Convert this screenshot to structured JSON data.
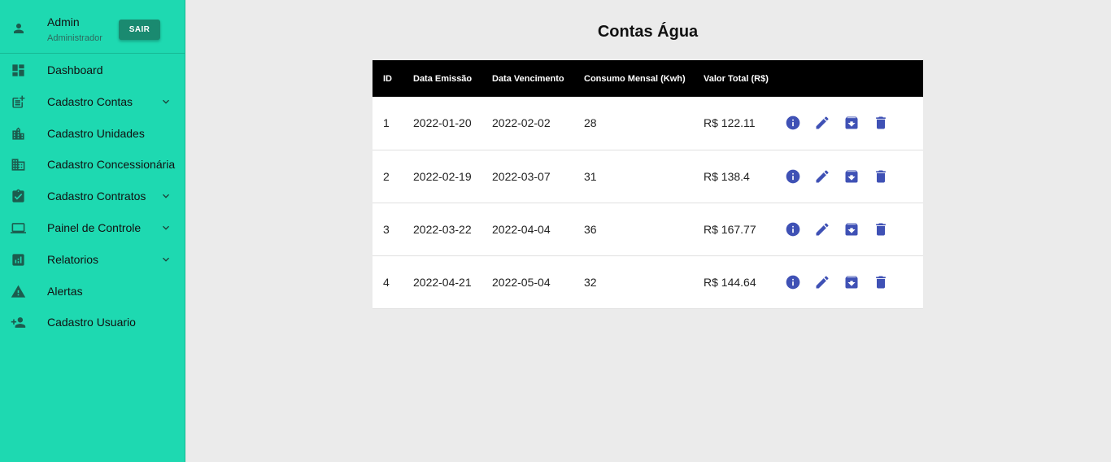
{
  "user": {
    "name": "Admin",
    "role": "Administrador",
    "logout_label": "SAIR"
  },
  "sidebar": {
    "items": [
      {
        "label": "Dashboard",
        "icon": "dashboard-icon",
        "expandable": false
      },
      {
        "label": "Cadastro Contas",
        "icon": "post-add-icon",
        "expandable": true
      },
      {
        "label": "Cadastro Unidades",
        "icon": "location-city-icon",
        "expandable": false
      },
      {
        "label": "Cadastro Concessionária",
        "icon": "business-icon",
        "expandable": false
      },
      {
        "label": "Cadastro Contratos",
        "icon": "assignment-turned-in-icon",
        "expandable": true
      },
      {
        "label": "Painel de Controle",
        "icon": "laptop-icon",
        "expandable": true
      },
      {
        "label": "Relatorios",
        "icon": "analytics-icon",
        "expandable": true
      },
      {
        "label": "Alertas",
        "icon": "warning-icon",
        "expandable": false
      },
      {
        "label": "Cadastro Usuario",
        "icon": "person-add-icon",
        "expandable": false
      }
    ]
  },
  "page": {
    "title": "Contas Água"
  },
  "table": {
    "columns": [
      "ID",
      "Data Emissão",
      "Data Vencimento",
      "Consumo Mensal (Kwh)",
      "Valor Total (R$)"
    ],
    "rows": [
      {
        "id": "1",
        "emissao": "2022-01-20",
        "vencimento": "2022-02-02",
        "consumo": "28",
        "valor": "R$ 122.11"
      },
      {
        "id": "2",
        "emissao": "2022-02-19",
        "vencimento": "2022-03-07",
        "consumo": "31",
        "valor": "R$ 138.4"
      },
      {
        "id": "3",
        "emissao": "2022-03-22",
        "vencimento": "2022-04-04",
        "consumo": "36",
        "valor": "R$ 167.77"
      },
      {
        "id": "4",
        "emissao": "2022-04-21",
        "vencimento": "2022-05-04",
        "consumo": "32",
        "valor": "R$ 144.64"
      }
    ],
    "row_actions": [
      "info-icon",
      "edit-icon",
      "archive-icon",
      "delete-icon"
    ]
  },
  "colors": {
    "sidebar": "#1ed9b1",
    "accent": "#3f51b5",
    "header": "#000000",
    "logout_button": "#1a8a70"
  }
}
